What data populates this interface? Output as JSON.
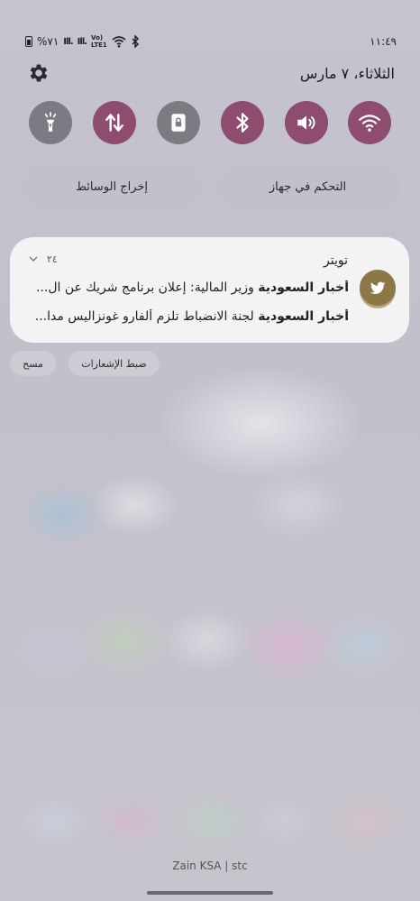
{
  "status_bar": {
    "time": "١١:٤٩",
    "battery": "%٧١",
    "signal_1": "Ill.",
    "signal_2": "Ill.",
    "volte_1": "Vo)",
    "volte_2": "LTE1"
  },
  "header": {
    "date": "الثلاثاء، ٧ مارس"
  },
  "quick_tiles": [
    {
      "name": "flashlight",
      "active": false
    },
    {
      "name": "mobile-data",
      "active": true
    },
    {
      "name": "rotation-lock",
      "active": false
    },
    {
      "name": "bluetooth",
      "active": true
    },
    {
      "name": "sound",
      "active": true
    },
    {
      "name": "wifi",
      "active": true
    }
  ],
  "colors": {
    "tile_active": "#8e4c6f",
    "tile_inactive": "#7c7a82",
    "avatar": "#8b7846"
  },
  "panel_buttons": {
    "device_control": "التحكم في جهاز",
    "media_output": "إخراج الوسائط"
  },
  "notification": {
    "app": "تويتر",
    "time": "٢٤",
    "line1_source": "أخبار السعودية",
    "line1_text": "وزير المالية:  إعلان برنامج شريك عن ال...",
    "line2_source": "أخبار السعودية",
    "line2_text": "لجنة الانضباط تلزم ألفارو غونزاليس مدا..."
  },
  "actions": {
    "notification_settings": "ضبط الإشعارات",
    "clear": "مسح"
  },
  "carrier": "Zain KSA | stc"
}
